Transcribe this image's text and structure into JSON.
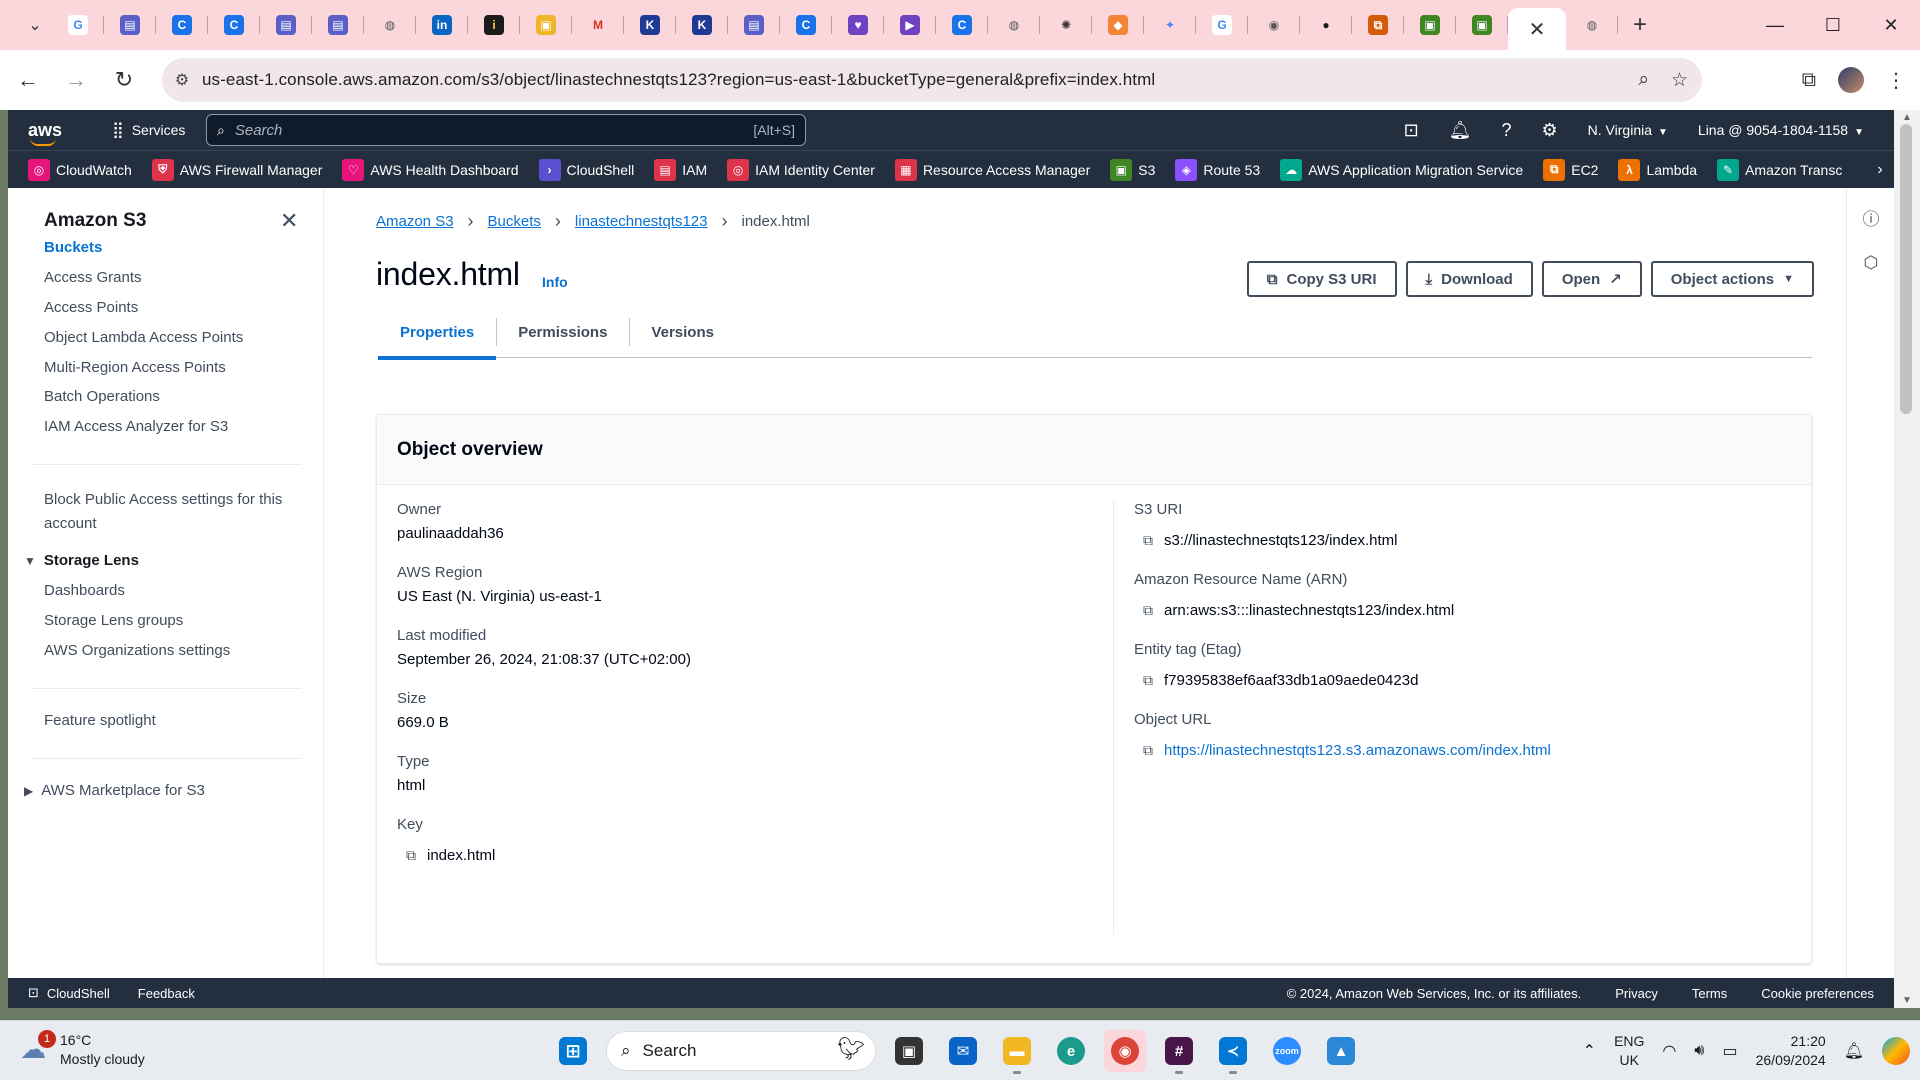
{
  "browser": {
    "tab_icons": [
      {
        "name": "google-tab-icon",
        "glyph": "G",
        "color": "#ffffff",
        "fg": "#4285f4"
      },
      {
        "name": "chat-tab-icon",
        "glyph": "▤",
        "color": "#5b5fc7",
        "fg": "#ffffff"
      },
      {
        "name": "edge-tab-icon",
        "glyph": "C",
        "color": "#1a73e8",
        "fg": "#ffffff"
      },
      {
        "name": "edge-tab-icon-2",
        "glyph": "C",
        "color": "#1a73e8",
        "fg": "#ffffff"
      },
      {
        "name": "chat-tab-icon-2",
        "glyph": "▤",
        "color": "#5b5fc7",
        "fg": "#ffffff"
      },
      {
        "name": "chat-tab-icon-3",
        "glyph": "▤",
        "color": "#5b5fc7",
        "fg": "#ffffff"
      },
      {
        "name": "globe-tab-icon",
        "glyph": "◍",
        "color": "transparent",
        "fg": "#555555"
      },
      {
        "name": "linkedin-tab-icon",
        "glyph": "in",
        "color": "#0a66c2",
        "fg": "#ffffff"
      },
      {
        "name": "info-tab-icon",
        "glyph": "i",
        "color": "#1b1b1b",
        "fg": "#ffd33d"
      },
      {
        "name": "box-tab-icon",
        "glyph": "▣",
        "color": "#f0b429",
        "fg": "#ffffff"
      },
      {
        "name": "gmail-tab-icon",
        "glyph": "M",
        "color": "transparent",
        "fg": "#d93025"
      },
      {
        "name": "k-tab-icon",
        "glyph": "K",
        "color": "#1f3a93",
        "fg": "#ffffff"
      },
      {
        "name": "k-tab-icon-2",
        "glyph": "K",
        "color": "#1f3a93",
        "fg": "#ffffff"
      },
      {
        "name": "chat-tab-icon-4",
        "glyph": "▤",
        "color": "#5b5fc7",
        "fg": "#ffffff"
      },
      {
        "name": "edge-tab-icon-3",
        "glyph": "C",
        "color": "#1a73e8",
        "fg": "#ffffff"
      },
      {
        "name": "heart-tab-icon",
        "glyph": "♥",
        "color": "#6f42c1",
        "fg": "#ffffff"
      },
      {
        "name": "video-tab-icon",
        "glyph": "▶",
        "color": "#6f42c1",
        "fg": "#ffffff"
      },
      {
        "name": "edge-tab-icon-4",
        "glyph": "C",
        "color": "#1a73e8",
        "fg": "#ffffff"
      },
      {
        "name": "globe-tab-icon-2",
        "glyph": "◍",
        "color": "transparent",
        "fg": "#555555"
      },
      {
        "name": "openai-tab-icon",
        "glyph": "✺",
        "color": "transparent",
        "fg": "#333333"
      },
      {
        "name": "aws-cube-tab-icon",
        "glyph": "◆",
        "color": "#f58536",
        "fg": "#ffffff"
      },
      {
        "name": "gemini-tab-icon",
        "glyph": "✦",
        "color": "transparent",
        "fg": "#4285f4"
      },
      {
        "name": "google-tab-icon-2",
        "glyph": "G",
        "color": "#ffffff",
        "fg": "#4285f4"
      },
      {
        "name": "chrome-tab-icon",
        "glyph": "◉",
        "color": "transparent",
        "fg": "#555555"
      },
      {
        "name": "github-tab-icon",
        "glyph": "●",
        "color": "transparent",
        "fg": "#1b1b1b"
      },
      {
        "name": "aws-orange-tab-icon",
        "glyph": "⧉",
        "color": "#d45b07",
        "fg": "#ffffff"
      },
      {
        "name": "aws-green-tab-icon",
        "glyph": "▣",
        "color": "#3f8624",
        "fg": "#ffffff"
      },
      {
        "name": "aws-green-tab-icon-2",
        "glyph": "▣",
        "color": "#3f8624",
        "fg": "#ffffff"
      }
    ],
    "active_tab_close": "✕",
    "new_tab": "+",
    "url": "us-east-1.console.aws.amazon.com/s3/object/linastechnestqts123?region=us-east-1&bucketType=general&prefix=index.html"
  },
  "aws_header": {
    "logo": "aws",
    "services": "Services",
    "search_placeholder": "Search",
    "search_shortcut": "[Alt+S]",
    "region": "N. Virginia",
    "account": "Lina @ 9054-1804-1158"
  },
  "favorites": [
    {
      "label": "CloudWatch",
      "icon": "cloudwatch-icon",
      "color": "#e7157b",
      "glyph": "◎"
    },
    {
      "label": "AWS Firewall Manager",
      "icon": "firewall-icon",
      "color": "#dd344c",
      "glyph": "⛨"
    },
    {
      "label": "AWS Health Dashboard",
      "icon": "health-icon",
      "color": "#e7157b",
      "glyph": "♡"
    },
    {
      "label": "CloudShell",
      "icon": "cloudshell-icon",
      "color": "#5a4fcf",
      "glyph": "›"
    },
    {
      "label": "IAM",
      "icon": "iam-icon",
      "color": "#dd344c",
      "glyph": "▤"
    },
    {
      "label": "IAM Identity Center",
      "icon": "identity-center-icon",
      "color": "#dd344c",
      "glyph": "◎"
    },
    {
      "label": "Resource Access Manager",
      "icon": "ram-icon",
      "color": "#dd344c",
      "glyph": "▦"
    },
    {
      "label": "S3",
      "icon": "s3-icon",
      "color": "#3f8624",
      "glyph": "▣"
    },
    {
      "label": "Route 53",
      "icon": "route53-icon",
      "color": "#8c4fff",
      "glyph": "◈"
    },
    {
      "label": "AWS Application Migration Service",
      "icon": "migration-icon",
      "color": "#01a88d",
      "glyph": "☁"
    },
    {
      "label": "EC2",
      "icon": "ec2-icon",
      "color": "#ed7100",
      "glyph": "⧉"
    },
    {
      "label": "Lambda",
      "icon": "lambda-icon",
      "color": "#ed7100",
      "glyph": "λ"
    },
    {
      "label": "Amazon Transc",
      "icon": "transcribe-icon",
      "color": "#01a88d",
      "glyph": "✎"
    }
  ],
  "sidebar": {
    "title": "Amazon S3",
    "items": [
      "Buckets",
      "Access Grants",
      "Access Points",
      "Object Lambda Access Points",
      "Multi-Region Access Points",
      "Batch Operations",
      "IAM Access Analyzer for S3"
    ],
    "block_public_access": "Block Public Access settings for this account",
    "storage_lens": {
      "title": "Storage Lens",
      "items": [
        "Dashboards",
        "Storage Lens groups",
        "AWS Organizations settings"
      ]
    },
    "feature_spotlight": "Feature spotlight",
    "marketplace": "AWS Marketplace for S3"
  },
  "breadcrumb": {
    "items": [
      "Amazon S3",
      "Buckets",
      "linastechnestqts123"
    ],
    "current": "index.html"
  },
  "page": {
    "title": "index.html",
    "info": "Info",
    "buttons": {
      "copy_uri": "Copy S3 URI",
      "download": "Download",
      "open": "Open",
      "object_actions": "Object actions"
    },
    "tabs": [
      "Properties",
      "Permissions",
      "Versions"
    ],
    "selected_tab": "Properties"
  },
  "overview": {
    "heading": "Object overview",
    "left": [
      {
        "label": "Owner",
        "value": "paulinaaddah36"
      },
      {
        "label": "AWS Region",
        "value": "US East (N. Virginia) us-east-1"
      },
      {
        "label": "Last modified",
        "value": "September 26, 2024, 21:08:37 (UTC+02:00)"
      },
      {
        "label": "Size",
        "value": "669.0 B"
      },
      {
        "label": "Type",
        "value": "html"
      },
      {
        "label": "Key",
        "value": "index.html"
      }
    ],
    "right": [
      {
        "label": "S3 URI",
        "value": "s3://linastechnestqts123/index.html"
      },
      {
        "label": "Amazon Resource Name (ARN)",
        "value": "arn:aws:s3:::linastechnestqts123/index.html"
      },
      {
        "label": "Entity tag (Etag)",
        "value": "f79395838ef6aaf33db1a09aede0423d"
      },
      {
        "label": "Object URL",
        "value": "https://linastechnestqts123.s3.amazonaws.com/index.html"
      }
    ]
  },
  "footer": {
    "cloudshell": "CloudShell",
    "feedback": "Feedback",
    "copyright": "© 2024, Amazon Web Services, Inc. or its affiliates.",
    "privacy": "Privacy",
    "terms": "Terms",
    "cookie": "Cookie preferences"
  },
  "taskbar": {
    "weather_temp": "16°C",
    "weather_desc": "Mostly cloudy",
    "weather_badge": "1",
    "search": "Search",
    "lang1": "ENG",
    "lang2": "UK",
    "time": "21:20",
    "date": "26/09/2024"
  }
}
